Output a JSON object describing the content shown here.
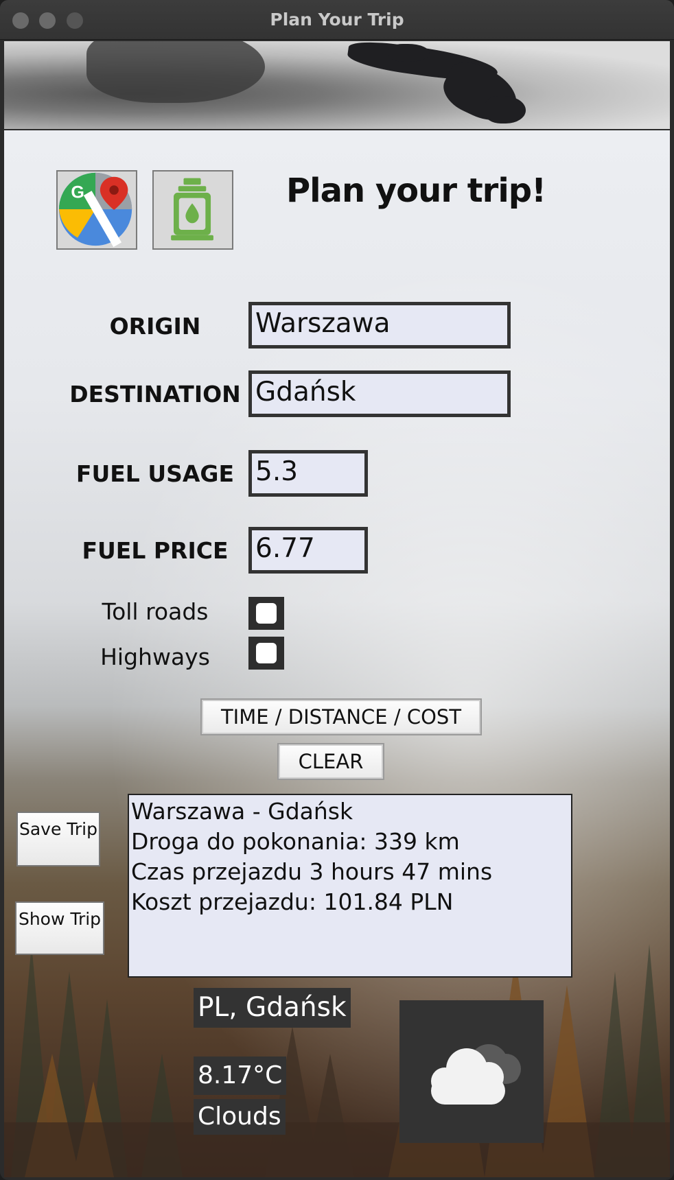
{
  "window": {
    "title": "Plan Your Trip"
  },
  "header": {
    "headline": "Plan your trip!"
  },
  "form": {
    "origin": {
      "label": "ORIGIN",
      "value": "Warszawa"
    },
    "destination": {
      "label": "DESTINATION",
      "value": "Gdańsk"
    },
    "fuel_usage": {
      "label": "FUEL USAGE",
      "value": "5.3"
    },
    "fuel_price": {
      "label": "FUEL PRICE",
      "value": "6.77"
    },
    "toll_roads": {
      "label": "Toll roads",
      "checked": false
    },
    "highways": {
      "label": "Highways",
      "checked": false
    }
  },
  "buttons": {
    "calculate": "TIME / DISTANCE / COST",
    "clear": "CLEAR",
    "save_trip": "Save Trip",
    "show_trip": "Show Trip"
  },
  "result": {
    "lines": [
      "Warszawa - Gdańsk",
      "Droga do pokonania: 339 km",
      "Czas przejazdu 3 hours 47 mins",
      "Koszt przejazdu: 101.84 PLN"
    ]
  },
  "weather": {
    "location": "PL, Gdańsk",
    "temperature": "8.17°C",
    "condition": "Clouds",
    "icon": "clouds-icon"
  },
  "icons": {
    "maps": "google-maps-icon",
    "fuel": "fuel-pump-icon"
  }
}
